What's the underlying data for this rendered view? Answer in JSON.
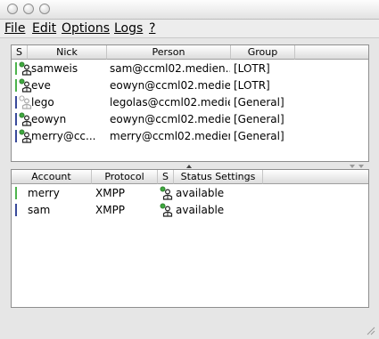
{
  "menu": [
    "File",
    "Edit",
    "Options",
    "Logs",
    "?"
  ],
  "contacts": {
    "headers": [
      "S",
      "Nick",
      "Person",
      "Group"
    ],
    "rows": [
      {
        "nick": "samweis",
        "person": "sam@ccml02.medien....",
        "group": "[LOTR]",
        "bar_color": "#4db34d"
      },
      {
        "nick": "eve",
        "person": "eowyn@ccml02.medien...",
        "group": "[LOTR]",
        "bar_color": "#4db34d"
      },
      {
        "nick": "lego",
        "person": "legolas@ccml02.medie...",
        "group": "[General]",
        "bar_color": "#3a4a9a"
      },
      {
        "nick": "eowyn",
        "person": "eowyn@ccml02.medie...",
        "group": "[General]",
        "bar_color": "#3a4a9a"
      },
      {
        "nick": "merry@cc...",
        "person": "merry@ccml02.medien...",
        "group": "[General]",
        "bar_color": "#3a4a9a"
      }
    ]
  },
  "accounts": {
    "headers": [
      "Account",
      "Protocol",
      "S",
      "Status Settings"
    ],
    "rows": [
      {
        "account": "merry",
        "protocol": "XMPP",
        "status": "available",
        "bar_color": "#4db34d"
      },
      {
        "account": "sam",
        "protocol": "XMPP",
        "status": "available",
        "bar_color": "#3a4a9a"
      }
    ]
  },
  "icons": {
    "user_online": "user-online-icon",
    "user_offline": "user-offline-icon",
    "divider_up": "triangle-up-icon",
    "divider_down": "triangle-down-icon"
  }
}
